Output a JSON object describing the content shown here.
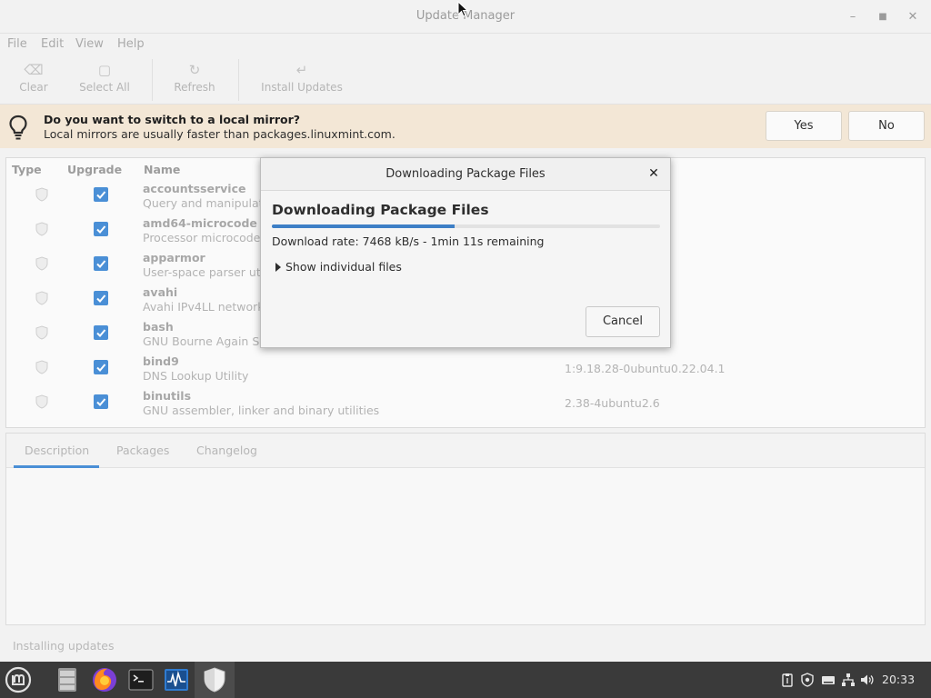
{
  "window": {
    "title": "Update Manager"
  },
  "menu": [
    "File",
    "Edit",
    "View",
    "Help"
  ],
  "toolbar": {
    "clear": "Clear",
    "select_all": "Select All",
    "refresh": "Refresh",
    "install": "Install Updates"
  },
  "infobar": {
    "title": "Do you want to switch to a local mirror?",
    "subtitle": "Local mirrors are usually faster than packages.linuxmint.com.",
    "yes": "Yes",
    "no": "No"
  },
  "columns": {
    "type": "Type",
    "upgrade": "Upgrade",
    "name": "Name"
  },
  "packages": [
    {
      "name": "accountsservice",
      "desc": "Query and manipulat",
      "version": ""
    },
    {
      "name": "amd64-microcode",
      "desc": "Processor microcode",
      "version": ""
    },
    {
      "name": "apparmor",
      "desc": "User-space parser util",
      "version": ""
    },
    {
      "name": "avahi",
      "desc": "Avahi IPv4LL network",
      "version": ""
    },
    {
      "name": "bash",
      "desc": "GNU Bourne Again S",
      "version": ""
    },
    {
      "name": "bind9",
      "desc": "DNS Lookup Utility",
      "version": "1:9.18.28-0ubuntu0.22.04.1"
    },
    {
      "name": "binutils",
      "desc": "GNU assembler, linker and binary utilities",
      "version": "2.38-4ubuntu2.6"
    }
  ],
  "tabs": [
    "Description",
    "Packages",
    "Changelog"
  ],
  "status": "Installing updates",
  "dialog": {
    "title": "Downloading Package Files",
    "heading": "Downloading Package Files",
    "progress": 0.47,
    "rate": "Download rate: 7468 kB/s - 1min 11s remaining",
    "expander": "Show individual files",
    "cancel": "Cancel"
  },
  "taskbar": {
    "clock": "20:33"
  },
  "colors": {
    "accent": "#4a8fd6",
    "infobar": "#f3e7d6",
    "taskbar": "#3a3a3a"
  }
}
